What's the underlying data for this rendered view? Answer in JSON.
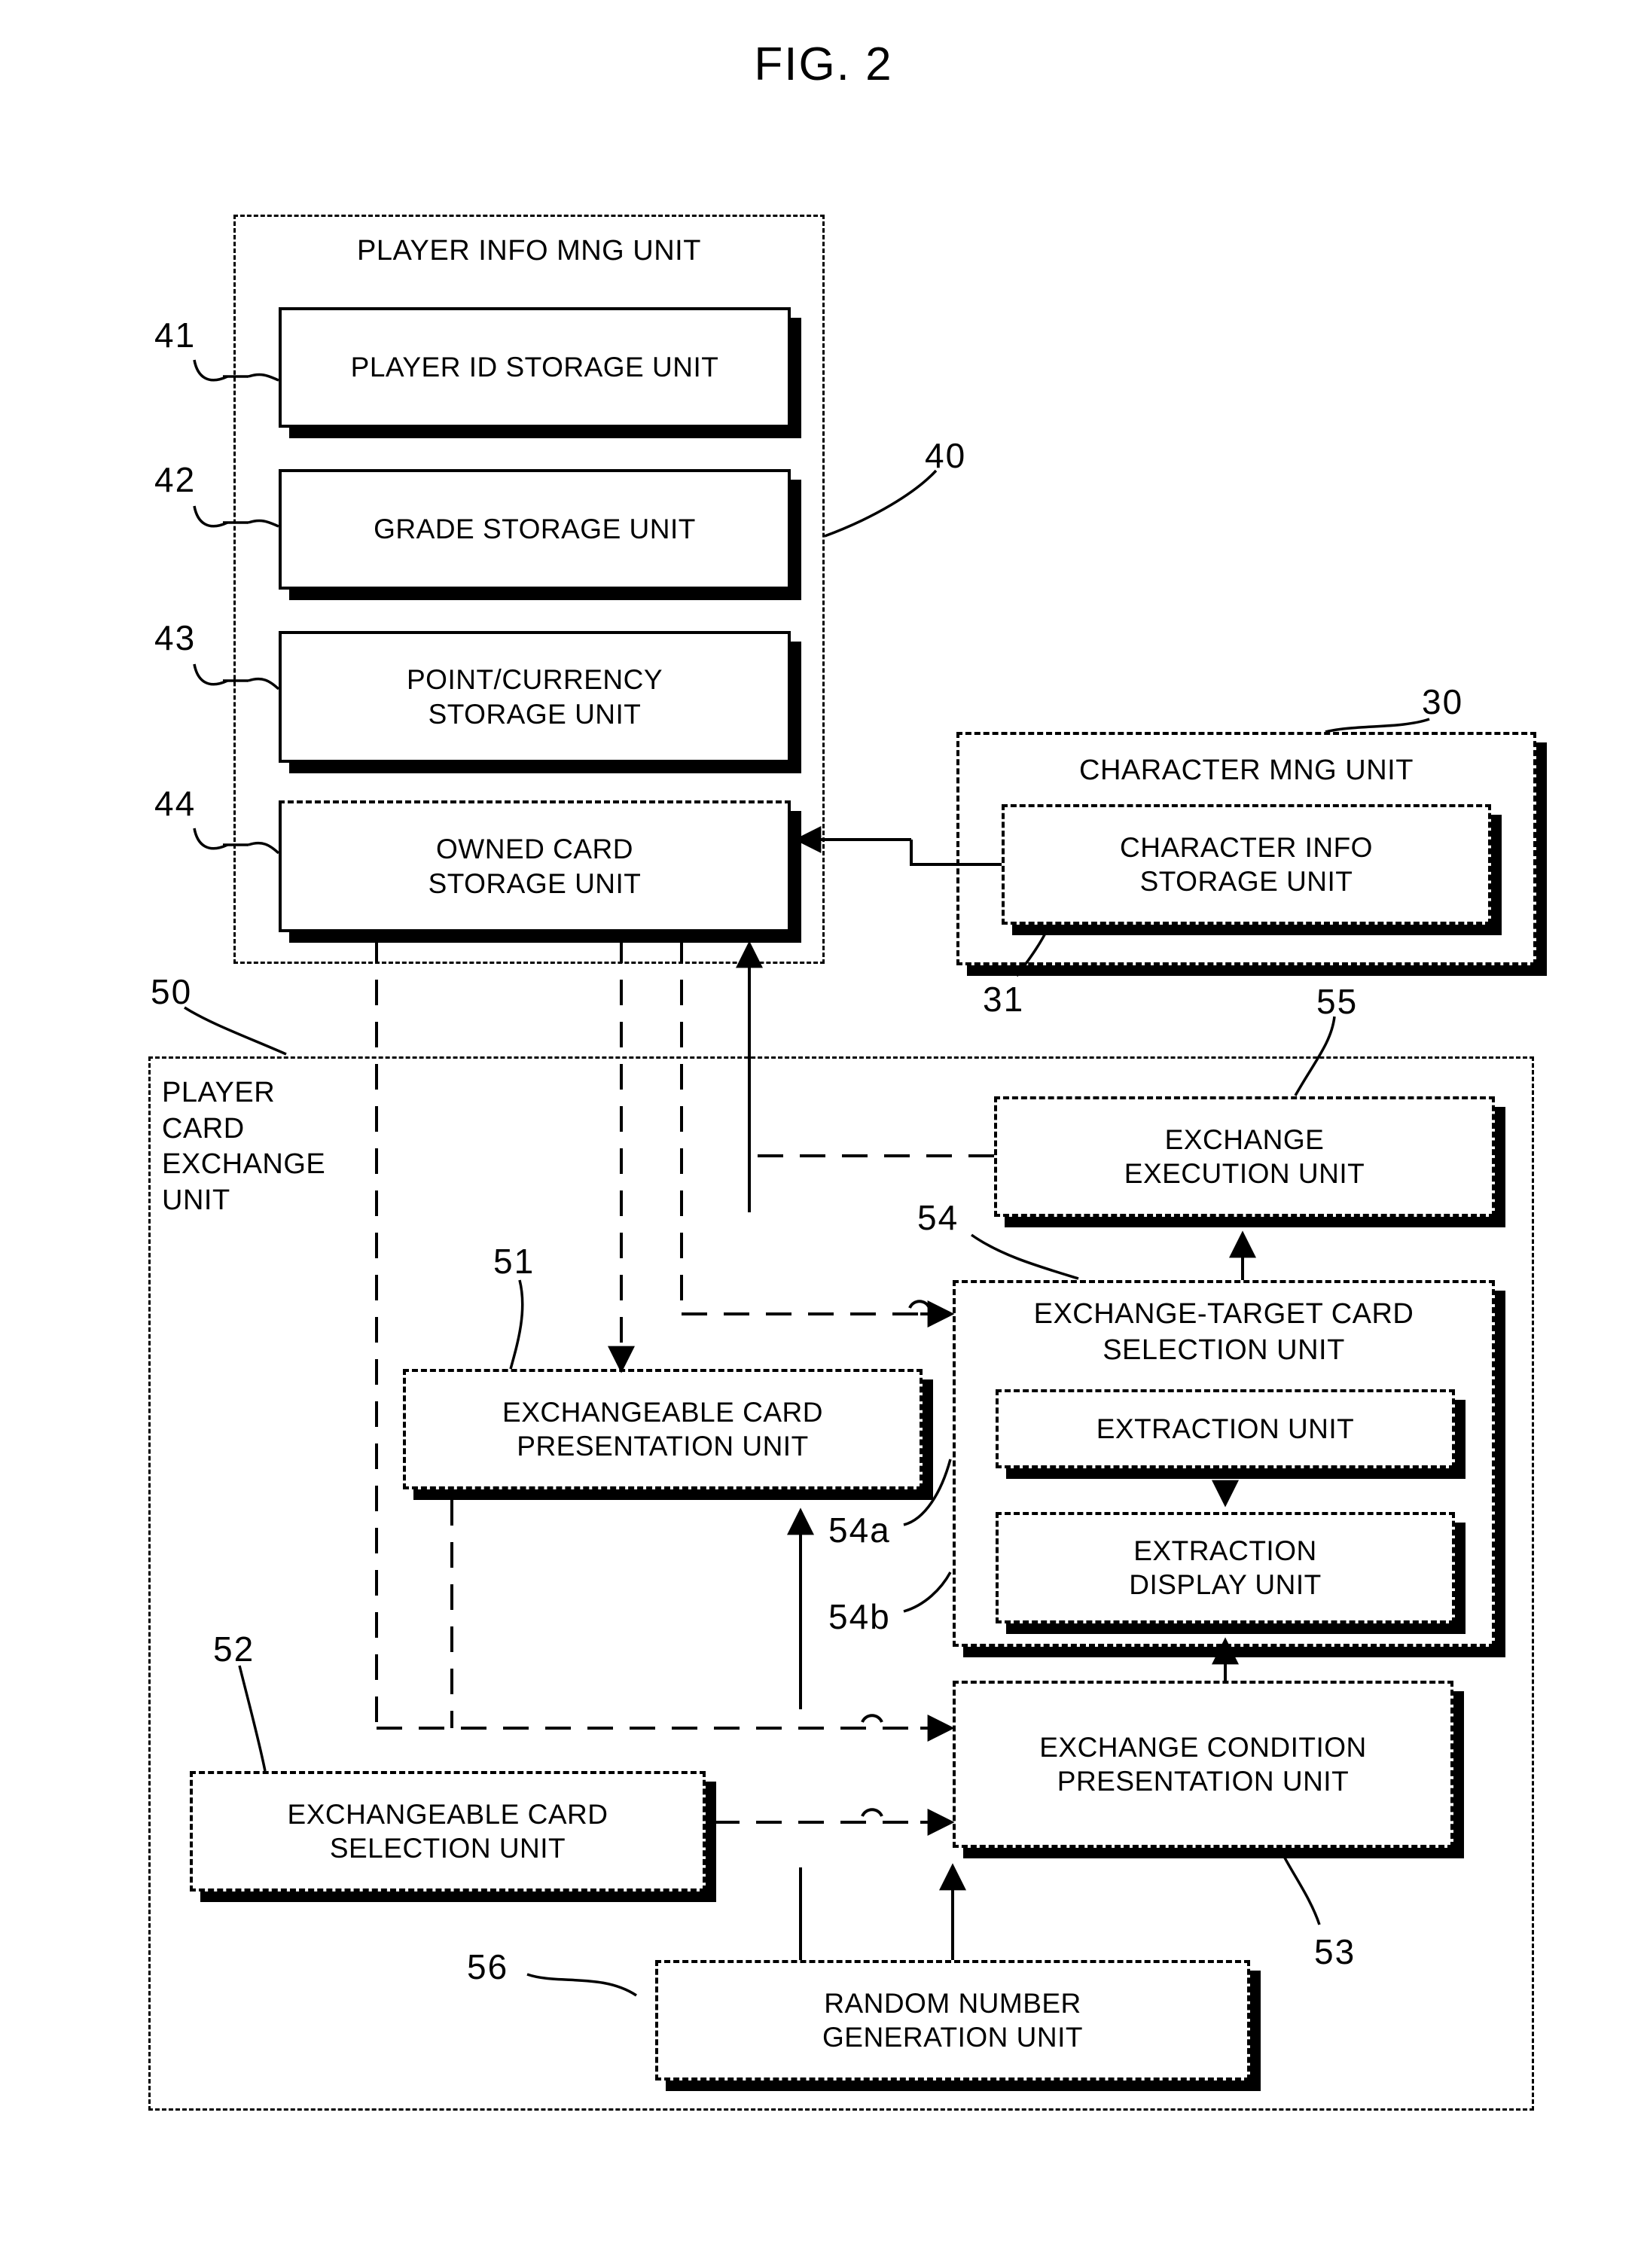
{
  "figure": {
    "title": "FIG. 2"
  },
  "groups": {
    "player_info_mng": {
      "label": "PLAYER INFO MNG UNIT",
      "ref": "40"
    },
    "character_mng": {
      "label": "CHARACTER MNG UNIT",
      "ref": "30"
    },
    "player_card_exchange": {
      "label": "PLAYER\nCARD\nEXCHANGE\nUNIT",
      "ref": "50"
    },
    "exchange_target_card_selection": {
      "label": "EXCHANGE-TARGET CARD\nSELECTION UNIT",
      "ref": "54"
    }
  },
  "blocks": {
    "player_id_storage": {
      "label": "PLAYER ID STORAGE UNIT",
      "ref": "41"
    },
    "grade_storage": {
      "label": "GRADE STORAGE UNIT",
      "ref": "42"
    },
    "point_currency_storage": {
      "label": "POINT/CURRENCY\nSTORAGE UNIT",
      "ref": "43"
    },
    "owned_card_storage": {
      "label": "OWNED CARD\nSTORAGE UNIT",
      "ref": "44"
    },
    "character_info_storage": {
      "label": "CHARACTER INFO\nSTORAGE UNIT",
      "ref": "31"
    },
    "exchange_execution": {
      "label": "EXCHANGE\nEXECUTION UNIT",
      "ref": "55"
    },
    "extraction": {
      "label": "EXTRACTION UNIT",
      "ref": "54a"
    },
    "extraction_display": {
      "label": "EXTRACTION\nDISPLAY UNIT",
      "ref": "54b"
    },
    "exchangeable_card_presentation": {
      "label": "EXCHANGEABLE CARD\nPRESENTATION UNIT",
      "ref": "51"
    },
    "exchangeable_card_selection": {
      "label": "EXCHANGEABLE CARD\nSELECTION UNIT",
      "ref": "52"
    },
    "exchange_condition_presentation": {
      "label": "EXCHANGE CONDITION\nPRESENTATION UNIT",
      "ref": "53"
    },
    "random_number_generation": {
      "label": "RANDOM NUMBER\nGENERATION UNIT",
      "ref": "56"
    }
  },
  "colors": {
    "ink": "#000000",
    "paper": "#ffffff"
  }
}
